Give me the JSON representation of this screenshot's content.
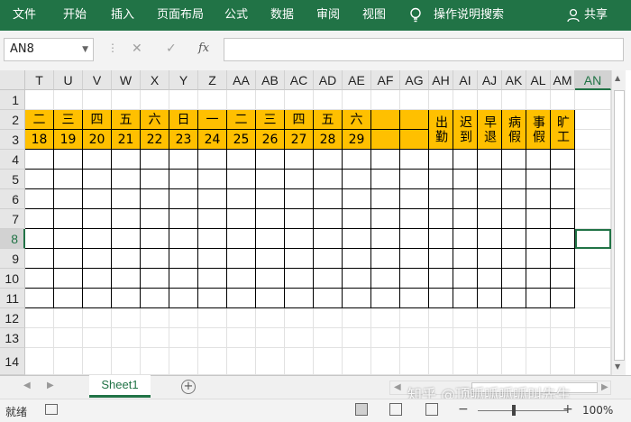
{
  "ribbon": {
    "tabs": [
      "文件",
      "开始",
      "插入",
      "页面布局",
      "公式",
      "数据",
      "审阅",
      "视图"
    ],
    "tell_me": "操作说明搜索",
    "share": "共享",
    "icons": {
      "tell_me": "lightbulb-icon",
      "share": "person-icon"
    }
  },
  "formula_bar": {
    "name_box": "AN8",
    "separator": "⋮",
    "cancel": "✕",
    "enter": "✓",
    "fx": "fx",
    "content": ""
  },
  "sheet": {
    "columns": [
      "T",
      "U",
      "V",
      "W",
      "X",
      "Y",
      "Z",
      "AA",
      "AB",
      "AC",
      "AD",
      "AE",
      "AF",
      "AG",
      "AH",
      "AI",
      "AJ",
      "AK",
      "AL",
      "AM",
      "AN"
    ],
    "selected_column": "AN",
    "rows": [
      "1",
      "2",
      "3",
      "4",
      "5",
      "6",
      "7",
      "8",
      "9",
      "10",
      "11",
      "12",
      "13",
      "14"
    ],
    "selected_row": "8",
    "selected_cell": "AN8",
    "weekday_row": [
      "二",
      "三",
      "四",
      "五",
      "六",
      "日",
      "一",
      "二",
      "三",
      "四",
      "五",
      "六",
      "",
      ""
    ],
    "day_row": [
      "18",
      "19",
      "20",
      "21",
      "22",
      "23",
      "24",
      "25",
      "26",
      "27",
      "28",
      "29",
      "",
      ""
    ],
    "summary_headers": [
      "出勤",
      "迟到",
      "早退",
      "病假",
      "事假",
      "旷工"
    ],
    "header_fill_color": "#FFC000"
  },
  "tabs_bar": {
    "sheet_tab": "Sheet1",
    "add_sheet": "+",
    "prev_sheet": "◀",
    "next_sheet": "▶",
    "scroll_left": "◀",
    "scroll_right": "▶"
  },
  "watermark": "知乎 @顶呱呱呱呱叫先生",
  "status_bar": {
    "ready": "就绪",
    "zoom_out": "−",
    "zoom_in": "+",
    "zoom": "100%"
  },
  "colors": {
    "accent": "#217346",
    "header_fill": "#FFC000"
  }
}
